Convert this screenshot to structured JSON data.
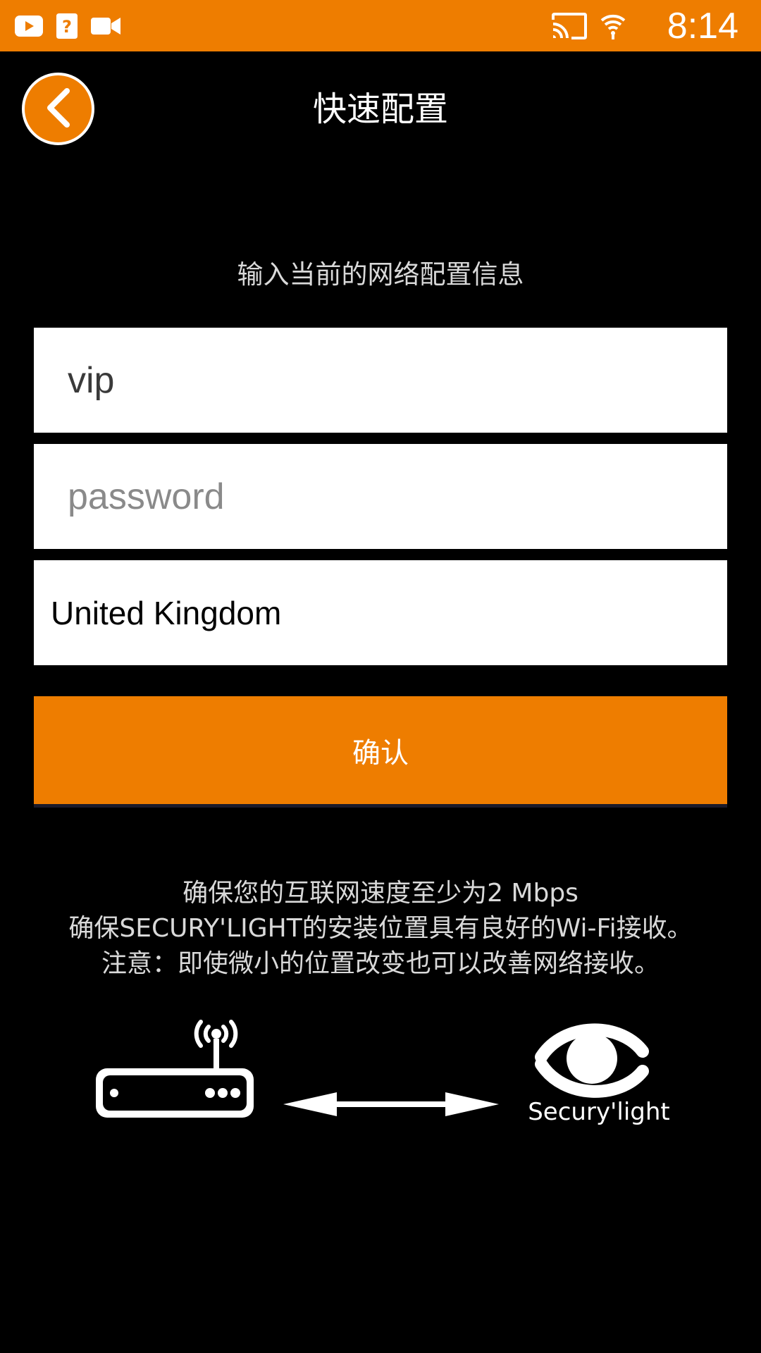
{
  "status_bar": {
    "time": "8:14",
    "background_color": "#EE7D00",
    "icons": [
      "youtube-icon",
      "help-icon",
      "video-camera-icon",
      "cast-icon",
      "wifi-icon"
    ]
  },
  "header": {
    "title": "快速配置",
    "back_icon": "chevron-left-icon"
  },
  "form": {
    "subtitle": "输入当前的网络配置信息",
    "ssid_value": "vip",
    "password_placeholder": "password",
    "country_value": "United Kingdom",
    "confirm_label": "确认"
  },
  "notes": {
    "line1": "确保您的互联网速度至少为2 Mbps",
    "line2": "确保SECURY'LIGHT的安装位置具有良好的Wi-Fi接收。",
    "line3": "注意：即使微小的位置改变也可以改善网络接收。"
  },
  "illustration": {
    "left_icon": "wifi-router-icon",
    "middle_icon": "double-arrow-icon",
    "right_icon": "eye-logo-icon",
    "brand_text": "Secury'light"
  },
  "colors": {
    "accent": "#EE7D00",
    "background": "#000000"
  }
}
